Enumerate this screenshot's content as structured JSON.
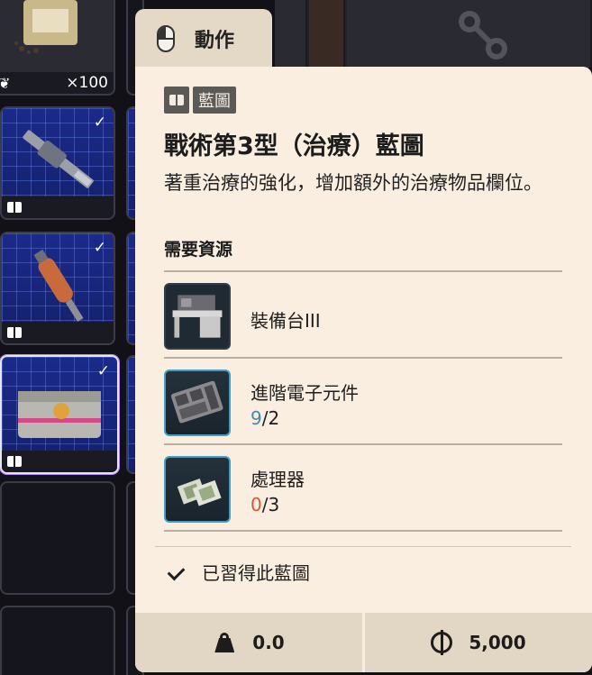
{
  "inventory": {
    "first_slot_count": "×100",
    "slots": [
      {
        "name": "seed-pouch",
        "checked": false
      },
      {
        "name": "rifle-blueprint",
        "checked": true
      },
      {
        "name": "injector-blueprint",
        "checked": true
      },
      {
        "name": "medkit-blueprint",
        "checked": true
      }
    ]
  },
  "action_tab": {
    "label": "動作",
    "icon": "mouse-icon"
  },
  "tooltip": {
    "badge_icon": "book-icon",
    "badge_label": "藍圖",
    "title": "戰術第3型（治療）藍圖",
    "description": "著重治療的強化，增加額外的治療物品欄位。",
    "requirements_title": "需要資源",
    "resources": [
      {
        "name": "裝備台III",
        "have": "",
        "need": "",
        "icon": "workbench-icon"
      },
      {
        "name": "進階電子元件",
        "have": "9",
        "need": "/2",
        "icon": "electronics-icon"
      },
      {
        "name": "處理器",
        "have": "0",
        "need": "/3",
        "icon": "processor-icon"
      }
    ],
    "learned_label": "已習得此藍圖",
    "weight": "0.0",
    "price": "5,000"
  },
  "colors": {
    "panel_bg": "#faeee0",
    "have_ok": "#4a88a6",
    "have_bad": "#d8553f",
    "accent_border": "#3ea0c8"
  }
}
